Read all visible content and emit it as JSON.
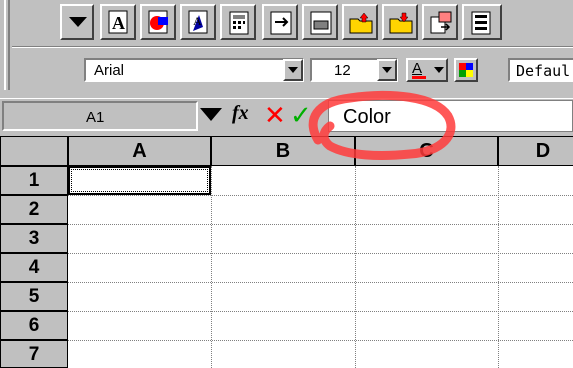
{
  "toolbar": {
    "icons": [
      "dropdown-arrow",
      "text-a-icon",
      "format-painter-icon",
      "fill-icon",
      "calculator-icon",
      "export-icon",
      "print-icon",
      "folder-up-icon",
      "folder-down-icon",
      "paste-icon",
      "grid-icon"
    ]
  },
  "format": {
    "font": "Arial",
    "size": "12",
    "font_color_label": "A",
    "style": "Defaul"
  },
  "formula_bar": {
    "name_box": "A1",
    "fx_label": "fx",
    "cancel_symbol": "✕",
    "confirm_symbol": "✓",
    "value": "Color"
  },
  "grid": {
    "columns": [
      "A",
      "B",
      "C",
      "D"
    ],
    "rows": [
      "1",
      "2",
      "3",
      "4",
      "5",
      "6",
      "7"
    ],
    "active_cell": "A1"
  },
  "colors": {
    "annotation": "#ff0000",
    "accept": "#00b000",
    "cancel": "#ff0000"
  }
}
